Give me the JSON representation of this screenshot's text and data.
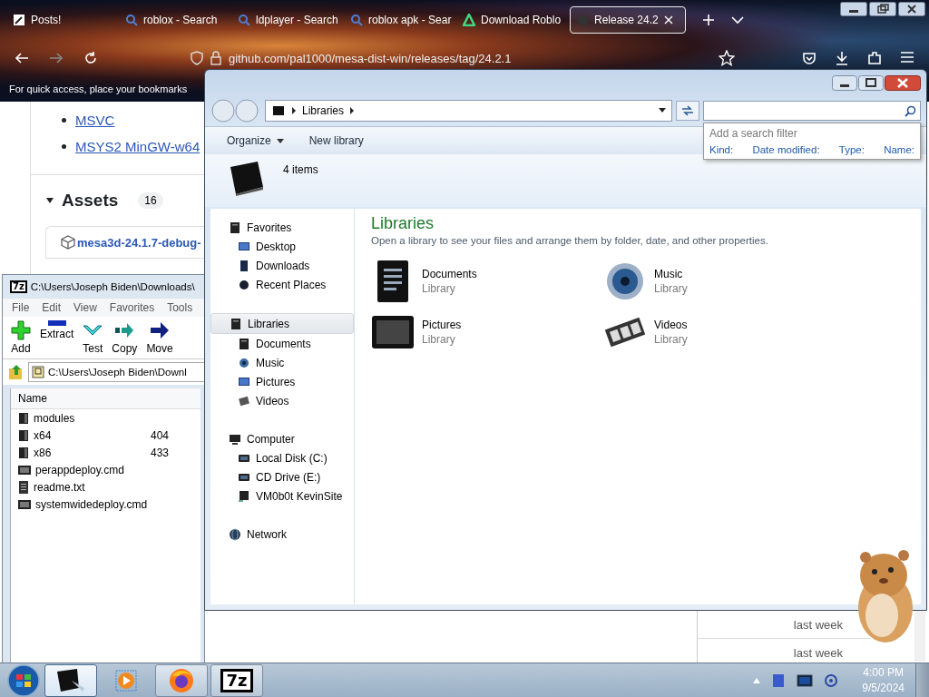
{
  "browser": {
    "tabs": [
      {
        "label": "Posts!",
        "kind": "site",
        "selected": false
      },
      {
        "label": "roblox - Search",
        "kind": "search",
        "selected": false
      },
      {
        "label": "ldplayer - Search",
        "kind": "search",
        "selected": false
      },
      {
        "label": "roblox apk - Sear",
        "kind": "search",
        "selected": false
      },
      {
        "label": "Download Roblo",
        "kind": "apk",
        "selected": false
      },
      {
        "label": "Release 24.2",
        "kind": "github",
        "selected": true
      }
    ],
    "url": "github.com/pal1000/mesa-dist-win/releases/tag/24.2.1",
    "bookmarks_hint": "For quick access, place your bookmarks",
    "page": {
      "links": [
        "MSVC",
        "MSYS2 MinGW-w64"
      ],
      "assets_heading": "Assets",
      "assets_count": "16",
      "asset": "mesa3d-24.1.7-debug-",
      "list_rows": [
        "last week",
        "last week"
      ]
    }
  },
  "archiver": {
    "logo": "7z",
    "title": "C:\\Users\\Joseph Biden\\Downloads\\",
    "menu": [
      "File",
      "Edit",
      "View",
      "Favorites",
      "Tools"
    ],
    "tools": [
      {
        "label": "Add",
        "kind": "add"
      },
      {
        "label": "Extract",
        "kind": "extract"
      },
      {
        "label": "Test",
        "kind": "test"
      },
      {
        "label": "Copy",
        "kind": "copy"
      },
      {
        "label": "Move",
        "kind": "move"
      }
    ],
    "path": "C:\\Users\\Joseph Biden\\Downl",
    "column": "Name",
    "rows": [
      {
        "name": "modules",
        "size": "",
        "kind": "folder"
      },
      {
        "name": "x64",
        "size": "404",
        "kind": "folder"
      },
      {
        "name": "x86",
        "size": "433",
        "kind": "folder"
      },
      {
        "name": "perappdeploy.cmd",
        "size": "",
        "kind": "cmd"
      },
      {
        "name": "readme.txt",
        "size": "",
        "kind": "txt"
      },
      {
        "name": "systemwidedeploy.cmd",
        "size": "",
        "kind": "cmd"
      }
    ]
  },
  "explorer": {
    "crumb": "Libraries",
    "search_hint": "Add a search filter",
    "filters": [
      "Kind:",
      "Date modified:",
      "Type:",
      "Name:"
    ],
    "toolbar": [
      "Organize",
      "New library"
    ],
    "count": "4 items",
    "nav": [
      {
        "label": "Favorites",
        "kind": "star",
        "selected": false,
        "children": [
          {
            "label": "Desktop",
            "kind": "desktop",
            "selected": false
          },
          {
            "label": "Downloads",
            "kind": "downloads",
            "selected": false
          },
          {
            "label": "Recent Places",
            "kind": "recent",
            "selected": false
          }
        ]
      },
      {
        "label": "Libraries",
        "kind": "library",
        "selected": true,
        "children": [
          {
            "label": "Documents",
            "kind": "documents",
            "selected": false
          },
          {
            "label": "Music",
            "kind": "music",
            "selected": false
          },
          {
            "label": "Pictures",
            "kind": "pictures",
            "selected": false
          },
          {
            "label": "Videos",
            "kind": "videos",
            "selected": false
          }
        ]
      },
      {
        "label": "Computer",
        "kind": "computer",
        "selected": false,
        "children": [
          {
            "label": "Local Disk (C:)",
            "kind": "disk",
            "selected": false
          },
          {
            "label": "CD Drive (E:)",
            "kind": "disk",
            "selected": false
          },
          {
            "label": "VM0b0t KevinSite",
            "kind": "share",
            "selected": false
          }
        ]
      },
      {
        "label": "Network",
        "kind": "network",
        "selected": false
      }
    ],
    "heading": "Libraries",
    "description": "Open a library to see your files and arrange them by folder, date, and other properties.",
    "libraries": [
      {
        "name": "Documents",
        "type": "Library",
        "kind": "documents"
      },
      {
        "name": "Music",
        "type": "Library",
        "kind": "music"
      },
      {
        "name": "Pictures",
        "type": "Library",
        "kind": "pictures"
      },
      {
        "name": "Videos",
        "type": "Library",
        "kind": "videos"
      }
    ]
  },
  "taskbar": {
    "buttons": [
      {
        "kind": "explorer",
        "selected": true
      },
      {
        "kind": "media",
        "selected": false
      },
      {
        "kind": "firefox",
        "selected": false
      },
      {
        "kind": "sevenzip",
        "selected": false,
        "label": "7z"
      }
    ],
    "time": "4:00 PM",
    "date": "9/5/2024"
  }
}
